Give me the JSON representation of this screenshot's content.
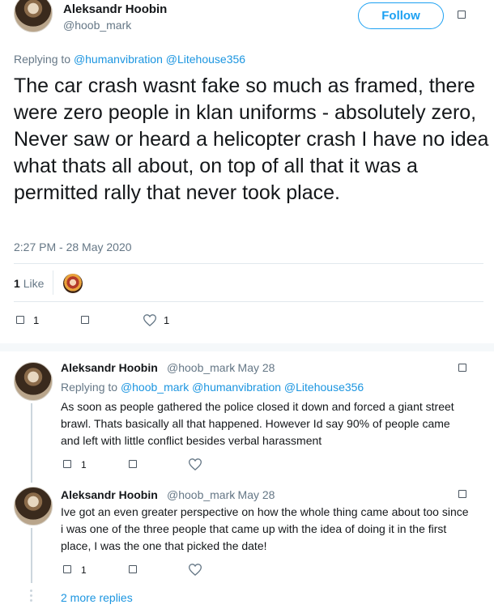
{
  "main_tweet": {
    "author_name": "Aleksandr Hoobin",
    "author_handle": "@hoob_mark",
    "follow_label": "Follow",
    "replying_to_prefix": "Replying to",
    "replying_to": [
      "@humanvibration",
      "@Litehouse356"
    ],
    "text": "The car crash wasnt fake so much as framed, there were zero people in klan uniforms - absolutely zero, Never saw or heard a helicopter crash I have no idea what thats all about, on top of all that it was a permitted rally that never took place.",
    "timestamp": "2:27 PM - 28 May 2020",
    "likes_count": "1",
    "likes_label": "Like",
    "reply_count": "1",
    "like_count": "1"
  },
  "replies": [
    {
      "author_name": "Aleksandr Hoobin",
      "author_handle": "@hoob_mark",
      "date": "· May 28",
      "replying_to_prefix": "Replying to",
      "replying_to": [
        "@hoob_mark",
        "@humanvibration",
        "@Litehouse356"
      ],
      "text": "As soon as people gathered the police closed it down and forced a giant street brawl. Thats basically all that happened.  However Id say 90% of people came and left with little conflict besides verbal harassment",
      "reply_count": "1"
    },
    {
      "author_name": "Aleksandr Hoobin",
      "author_handle": "@hoob_mark",
      "date": "· May 28",
      "text": "Ive got an even greater perspective on how the whole thing came about too since i was one of the three people that came up with the idea of doing it in the first place, I was the one that picked the date!",
      "reply_count": "1"
    }
  ],
  "more_replies_label": "2 more replies",
  "icons": {
    "reply": "square-outline-icon",
    "retweet": "square-outline-icon",
    "like": "heart-outline-icon",
    "more": "square-outline-icon"
  },
  "colors": {
    "accent": "#1da1f2",
    "link": "#1b95e0",
    "muted": "#657786"
  }
}
